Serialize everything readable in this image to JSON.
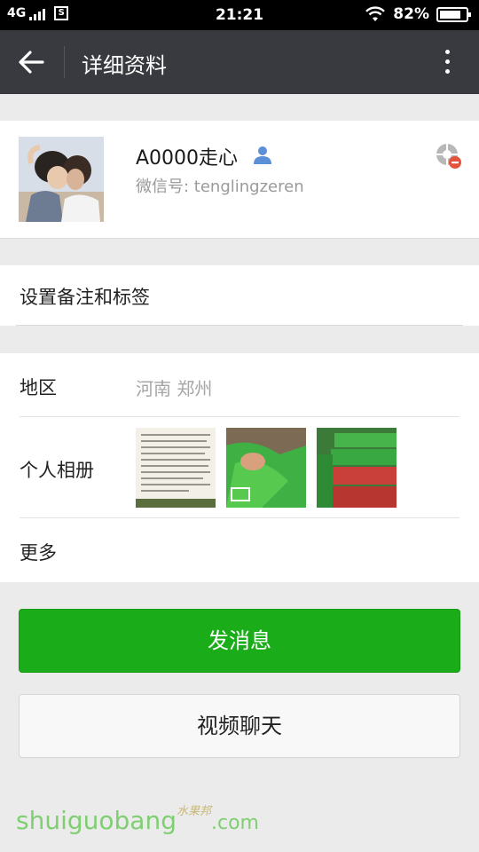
{
  "status_bar": {
    "network": "4G",
    "time": "21:21",
    "battery_text": "82%",
    "battery_level": 0.82,
    "sim_icon_label": "S"
  },
  "header": {
    "title": "详细资料",
    "back_icon": "arrow-left-icon",
    "menu_icon": "more-vertical-icon"
  },
  "profile": {
    "nickname": "A0000走心",
    "wechat_id": "微信号: tenglingzeren",
    "contact_icon": "person-icon",
    "action_icon": "block-icon"
  },
  "remark": {
    "label": "设置备注和标签"
  },
  "info": {
    "region_label": "地区",
    "region_value": "河南  郑州",
    "album_label": "个人相册",
    "more_label": "更多"
  },
  "buttons": {
    "send_message": "发消息",
    "video_chat": "视频聊天"
  },
  "watermark": {
    "text": "shuiguobang",
    "cn": "水果邦",
    "suffix": ".com"
  },
  "colors": {
    "action_bar": "#393a3f",
    "primary_green": "#1aad19",
    "background": "#ebebeb"
  }
}
